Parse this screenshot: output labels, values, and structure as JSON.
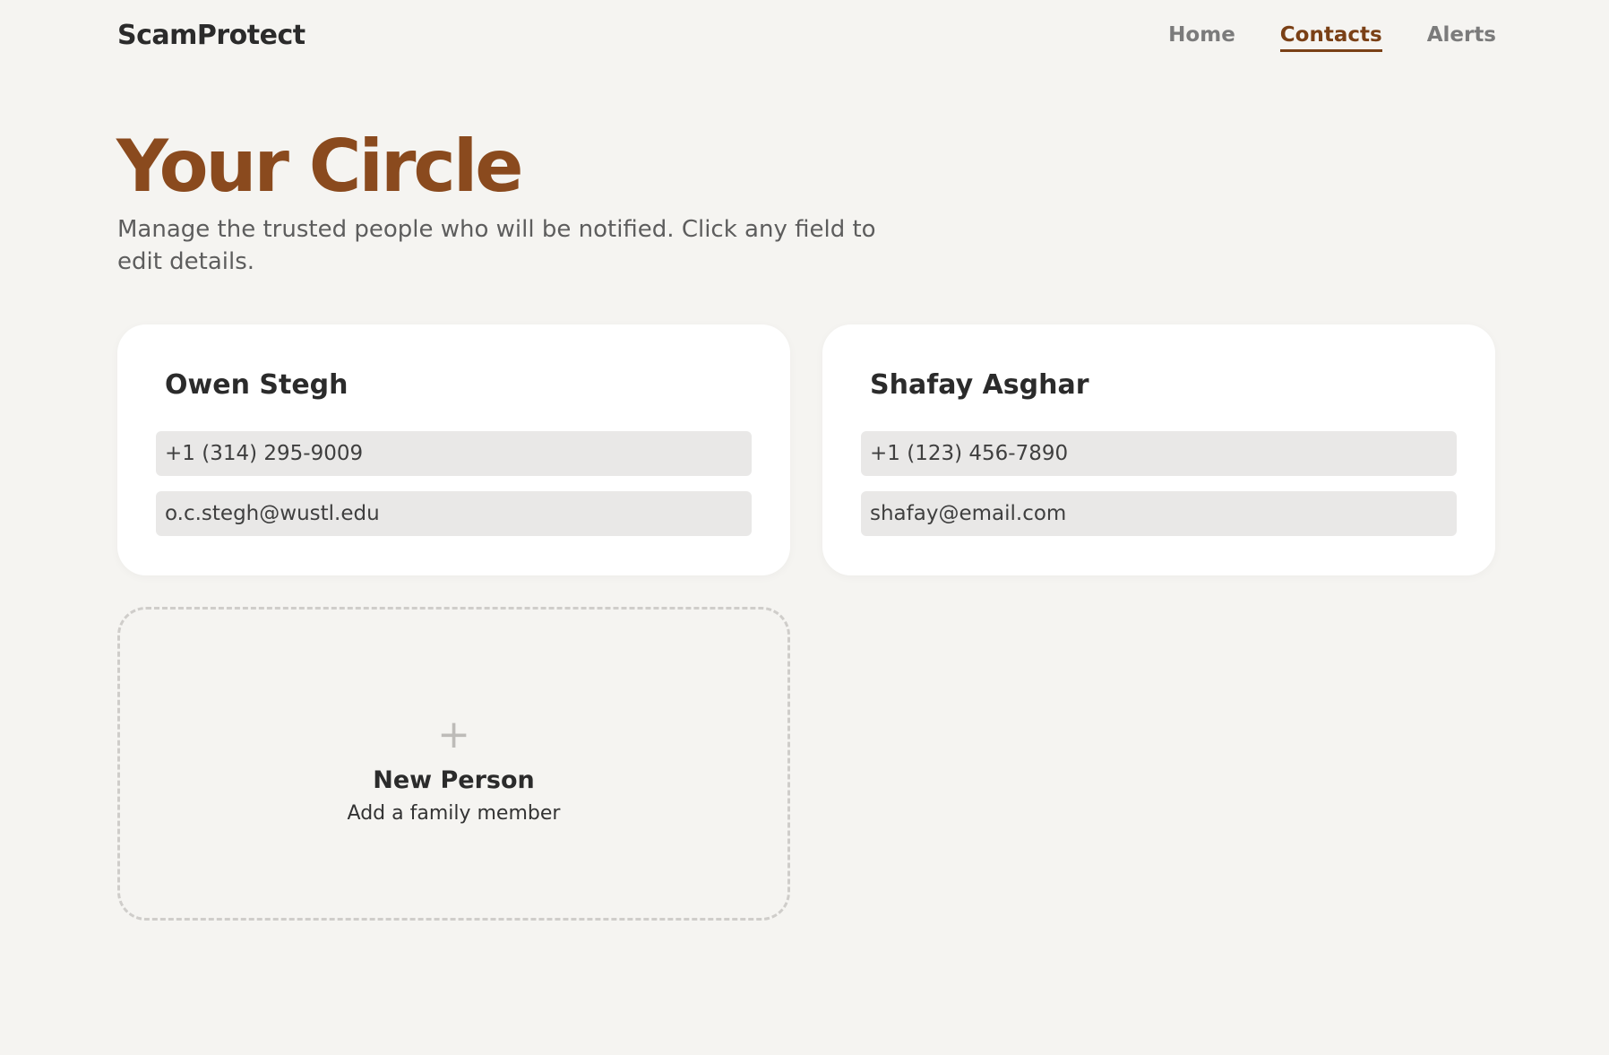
{
  "header": {
    "logo": "ScamProtect",
    "nav": [
      {
        "label": "Home",
        "active": false
      },
      {
        "label": "Contacts",
        "active": true
      },
      {
        "label": "Alerts",
        "active": false
      }
    ]
  },
  "page": {
    "title": "Your Circle",
    "subtitle": "Manage the trusted people who will be notified. Click any field to edit details."
  },
  "contacts": [
    {
      "name": "Owen Stegh",
      "phone": "+1 (314) 295-9009",
      "email": "o.c.stegh@wustl.edu"
    },
    {
      "name": "Shafay Asghar",
      "phone": "+1 (123) 456-7890",
      "email": "shafay@email.com"
    }
  ],
  "add_card": {
    "icon": "plus-icon",
    "plus_glyph": "+",
    "title": "New Person",
    "subtitle": "Add a family member"
  },
  "colors": {
    "background": "#f5f4f1",
    "accent": "#8a4a1e",
    "nav_active": "#7a4016",
    "card": "#ffffff",
    "field": "#e9e8e7"
  }
}
